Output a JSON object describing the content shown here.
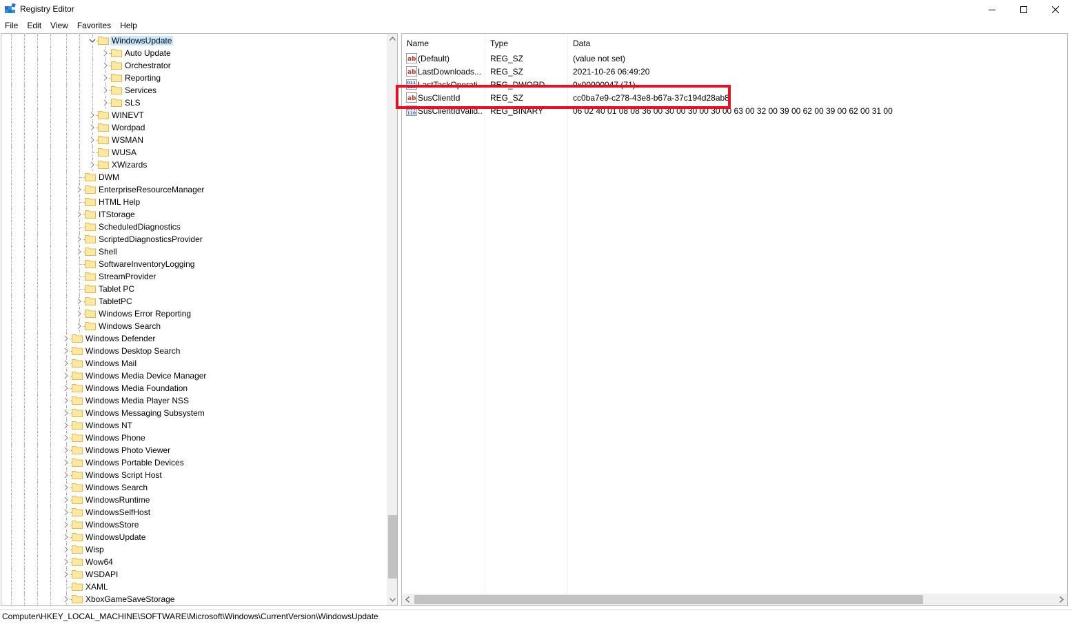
{
  "window": {
    "title": "Registry Editor"
  },
  "menu": [
    "File",
    "Edit",
    "View",
    "Favorites",
    "Help"
  ],
  "tree": [
    {
      "label": "WindowsUpdate",
      "level": 3,
      "expander": "expanded",
      "selected": true
    },
    {
      "label": "Auto Update",
      "level": 4,
      "expander": "collapsed"
    },
    {
      "label": "Orchestrator",
      "level": 4,
      "expander": "collapsed"
    },
    {
      "label": "Reporting",
      "level": 4,
      "expander": "collapsed"
    },
    {
      "label": "Services",
      "level": 4,
      "expander": "collapsed"
    },
    {
      "label": "SLS",
      "level": 4,
      "expander": "collapsed"
    },
    {
      "label": "WINEVT",
      "level": 3,
      "expander": "collapsed"
    },
    {
      "label": "Wordpad",
      "level": 3,
      "expander": "collapsed"
    },
    {
      "label": "WSMAN",
      "level": 3,
      "expander": "collapsed"
    },
    {
      "label": "WUSA",
      "level": 3,
      "expander": "none"
    },
    {
      "label": "XWizards",
      "level": 3,
      "expander": "collapsed"
    },
    {
      "label": "DWM",
      "level": 2,
      "expander": "none"
    },
    {
      "label": "EnterpriseResourceManager",
      "level": 2,
      "expander": "collapsed"
    },
    {
      "label": "HTML Help",
      "level": 2,
      "expander": "none"
    },
    {
      "label": "ITStorage",
      "level": 2,
      "expander": "collapsed"
    },
    {
      "label": "ScheduledDiagnostics",
      "level": 2,
      "expander": "none"
    },
    {
      "label": "ScriptedDiagnosticsProvider",
      "level": 2,
      "expander": "collapsed"
    },
    {
      "label": "Shell",
      "level": 2,
      "expander": "collapsed"
    },
    {
      "label": "SoftwareInventoryLogging",
      "level": 2,
      "expander": "none"
    },
    {
      "label": "StreamProvider",
      "level": 2,
      "expander": "none"
    },
    {
      "label": "Tablet PC",
      "level": 2,
      "expander": "none"
    },
    {
      "label": "TabletPC",
      "level": 2,
      "expander": "collapsed"
    },
    {
      "label": "Windows Error Reporting",
      "level": 2,
      "expander": "collapsed"
    },
    {
      "label": "Windows Search",
      "level": 2,
      "expander": "collapsed"
    },
    {
      "label": "Windows Defender",
      "level": 1,
      "expander": "collapsed"
    },
    {
      "label": "Windows Desktop Search",
      "level": 1,
      "expander": "collapsed"
    },
    {
      "label": "Windows Mail",
      "level": 1,
      "expander": "collapsed"
    },
    {
      "label": "Windows Media Device Manager",
      "level": 1,
      "expander": "collapsed"
    },
    {
      "label": "Windows Media Foundation",
      "level": 1,
      "expander": "collapsed"
    },
    {
      "label": "Windows Media Player NSS",
      "level": 1,
      "expander": "collapsed"
    },
    {
      "label": "Windows Messaging Subsystem",
      "level": 1,
      "expander": "collapsed"
    },
    {
      "label": "Windows NT",
      "level": 1,
      "expander": "collapsed"
    },
    {
      "label": "Windows Phone",
      "level": 1,
      "expander": "collapsed"
    },
    {
      "label": "Windows Photo Viewer",
      "level": 1,
      "expander": "collapsed"
    },
    {
      "label": "Windows Portable Devices",
      "level": 1,
      "expander": "collapsed"
    },
    {
      "label": "Windows Script Host",
      "level": 1,
      "expander": "collapsed"
    },
    {
      "label": "Windows Search",
      "level": 1,
      "expander": "collapsed"
    },
    {
      "label": "WindowsRuntime",
      "level": 1,
      "expander": "collapsed"
    },
    {
      "label": "WindowsSelfHost",
      "level": 1,
      "expander": "collapsed"
    },
    {
      "label": "WindowsStore",
      "level": 1,
      "expander": "collapsed"
    },
    {
      "label": "WindowsUpdate",
      "level": 1,
      "expander": "collapsed"
    },
    {
      "label": "Wisp",
      "level": 1,
      "expander": "collapsed"
    },
    {
      "label": "Wow64",
      "level": 1,
      "expander": "collapsed"
    },
    {
      "label": "WSDAPI",
      "level": 1,
      "expander": "collapsed"
    },
    {
      "label": "XAML",
      "level": 1,
      "expander": "none"
    },
    {
      "label": "XboxGameSaveStorage",
      "level": 1,
      "expander": "collapsed"
    }
  ],
  "values": {
    "columns": [
      "Name",
      "Type",
      "Data"
    ],
    "rows": [
      {
        "name": "(Default)",
        "type": "REG_SZ",
        "data": "(value not set)",
        "icon": "string-value-icon"
      },
      {
        "name": "LastDownloads...",
        "type": "REG_SZ",
        "data": "2021-10-26 06:49:20",
        "icon": "string-value-icon"
      },
      {
        "name": "LastTaskOperati...",
        "type": "REG_DWORD",
        "data": "0x00000047 (71)",
        "icon": "binary-value-icon"
      },
      {
        "name": "SusClientId",
        "type": "REG_SZ",
        "data": "cc0ba7e9-c278-43e8-b67a-37c194d28ab8",
        "icon": "string-value-icon"
      },
      {
        "name": "SusClientIdValid...",
        "type": "REG_BINARY",
        "data": "06 02 40 01 08 08 36 00 30 00 30 00 30 00 63 00 32 00 39 00 62 00 39 00 62 00 31 00",
        "icon": "binary-value-icon"
      }
    ],
    "highlighted_row": "SusClientId",
    "highlight_color": "#e81123"
  },
  "status_bar": {
    "path": "Computer\\HKEY_LOCAL_MACHINE\\SOFTWARE\\Microsoft\\Windows\\CurrentVersion\\WindowsUpdate"
  }
}
